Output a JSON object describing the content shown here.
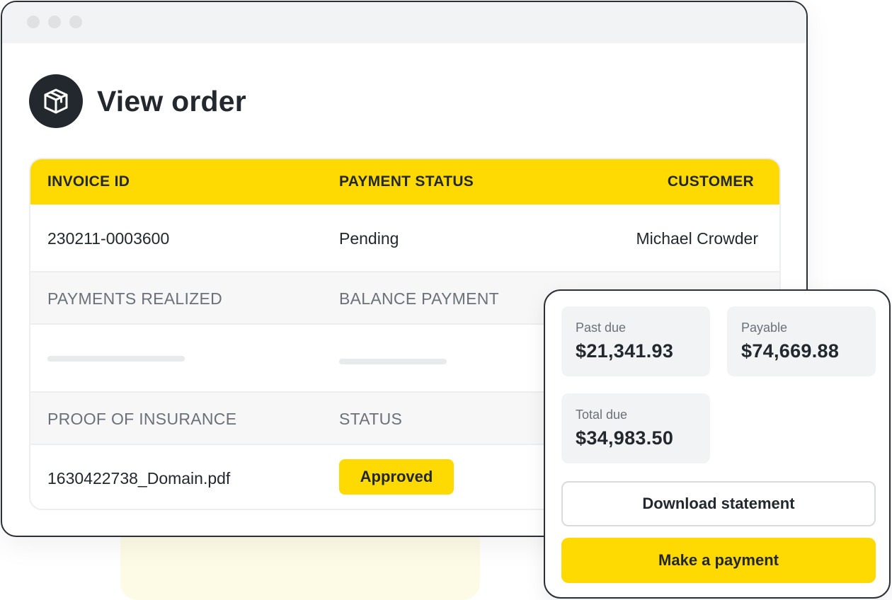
{
  "window": {
    "title": "View order",
    "icon": "package-box-icon"
  },
  "table": {
    "headers": [
      "INVOICE ID",
      "PAYMENT STATUS",
      "CUSTOMER"
    ],
    "row1": {
      "invoice_id": "230211-0003600",
      "payment_status": "Pending",
      "customer": "Michael Crowder"
    },
    "section2_labels": [
      "PAYMENTS REALIZED",
      "BALANCE PAYMENT"
    ],
    "section3_labels": [
      "PROOF OF INSURANCE",
      "STATUS"
    ],
    "row3": {
      "file": "1630422738_Domain.pdf",
      "status": "Approved"
    }
  },
  "summary": {
    "past_due": {
      "label": "Past due",
      "value": "$21,341.93"
    },
    "payable": {
      "label": "Payable",
      "value": "$74,669.88"
    },
    "total_due": {
      "label": "Total due",
      "value": "$34,983.50"
    },
    "download_label": "Download statement",
    "pay_label": "Make a payment"
  },
  "colors": {
    "accent": "#FFD902",
    "dark": "#22282E",
    "muted": "#6B7178",
    "panel": "#F2F3F4"
  }
}
